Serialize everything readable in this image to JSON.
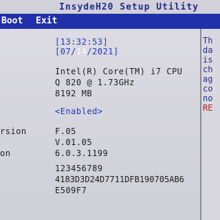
{
  "app": {
    "title": "InsydeH20 Setup Utility"
  },
  "menu": {
    "items": [
      "Boot",
      "Exit"
    ]
  },
  "main": {
    "time_text": "[13:32:53]",
    "date_prefix": "[07/",
    "date_day": "14",
    "date_suffix": "/2021]",
    "cpu_line1": "Intel(R) Core(TM) i7 CPU",
    "cpu_line2": "Q 820  @ 1.73GHz",
    "memory": "8192 MB",
    "enabled_value": "<Enabled>",
    "left_labels": [
      "rsion",
      "on"
    ],
    "bios_version": "F.05",
    "ec_version": "V.01.05",
    "me_version": "6.0.3.1199",
    "serial_number": "123456789",
    "uuid_line1": "4183D3D24D7711DFB190705AB6",
    "uuid_line2": "E509F7"
  },
  "help": {
    "lines": [
      "Th",
      "da",
      "is",
      "ch",
      "ag",
      "co",
      "no",
      "RE"
    ]
  },
  "colors": {
    "menu_bar": "#2030a8",
    "accent_blue": "#1f35c4",
    "help_red": "#b81c1c"
  }
}
